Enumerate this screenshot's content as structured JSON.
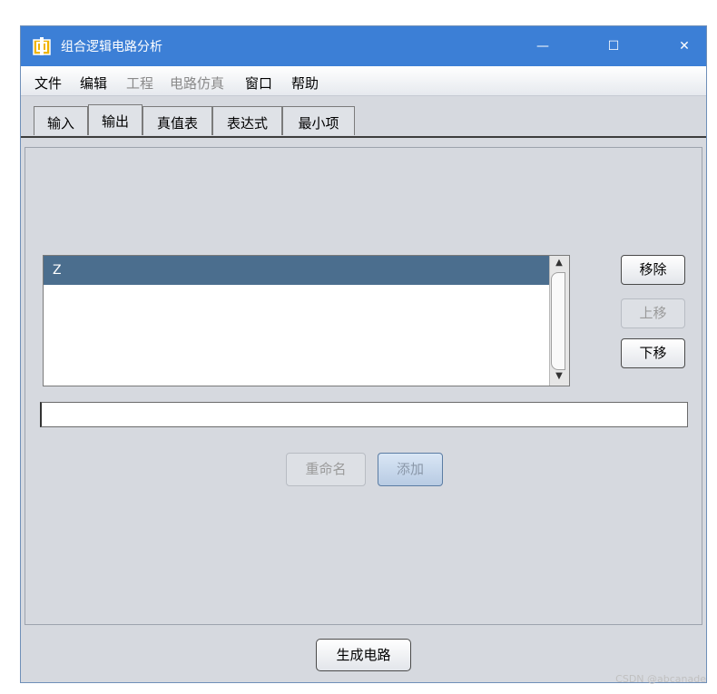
{
  "window": {
    "title": "组合逻辑电路分析",
    "controls": {
      "minimize": "—",
      "maximize": "☐",
      "close": "✕"
    }
  },
  "menu": {
    "items": [
      {
        "label": "文件",
        "enabled": true
      },
      {
        "label": "编辑",
        "enabled": true
      },
      {
        "label": "工程",
        "enabled": false
      },
      {
        "label": "电路仿真",
        "enabled": false
      },
      {
        "label": "窗口",
        "enabled": true
      },
      {
        "label": "帮助",
        "enabled": true
      }
    ]
  },
  "tabs": [
    {
      "label": "输入",
      "active": false
    },
    {
      "label": "输出",
      "active": true
    },
    {
      "label": "真值表",
      "active": false
    },
    {
      "label": "表达式",
      "active": false
    },
    {
      "label": "最小项",
      "active": false
    }
  ],
  "output_list": {
    "items": [
      "Z"
    ],
    "selected": "Z",
    "scroll_up": "▲",
    "scroll_down": "▼"
  },
  "side_buttons": {
    "remove": "移除",
    "move_up": "上移",
    "move_down": "下移"
  },
  "name_field": {
    "value": ""
  },
  "action_buttons": {
    "rename": "重命名",
    "add": "添加"
  },
  "footer": {
    "build_circuit": "生成电路"
  },
  "watermark": "CSDN @abcanade",
  "colors": {
    "titlebar": "#3c7fd6",
    "selection": "#4b6e8e",
    "panel": "#d6d9df"
  }
}
